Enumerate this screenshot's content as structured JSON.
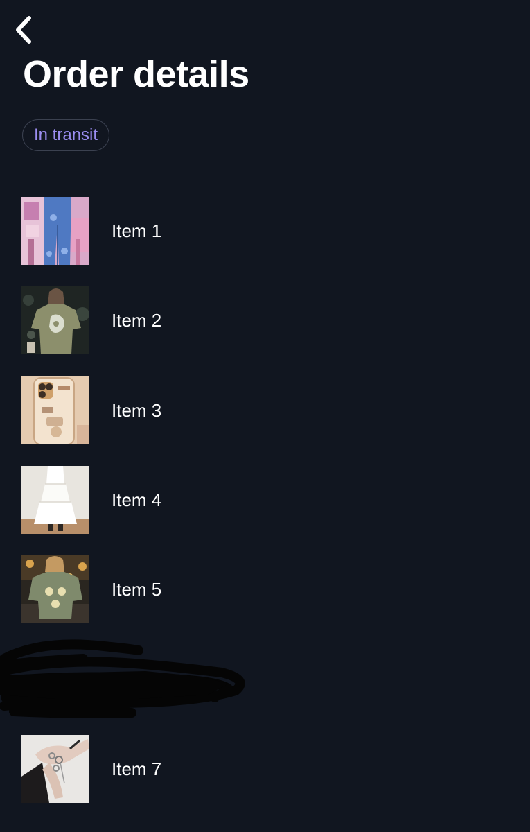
{
  "header": {
    "back_icon": "chevron-left-icon",
    "title": "Order details"
  },
  "status": {
    "label": "In transit",
    "color": "#9b8df0"
  },
  "colors": {
    "background": "#111620",
    "text": "#ffffff",
    "badge_border": "#3b4150"
  },
  "items": [
    {
      "label": "Item 1",
      "thumbnail": "blue-jeans-photo"
    },
    {
      "label": "Item 2",
      "thumbnail": "olive-graphic-tee-photo"
    },
    {
      "label": "Item 3",
      "thumbnail": "phone-case-photo"
    },
    {
      "label": "Item 4",
      "thumbnail": "white-tiered-skirt-photo"
    },
    {
      "label": "Item 5",
      "thumbnail": "green-skull-tee-photo"
    },
    {
      "label": "Item 7",
      "thumbnail": "silver-rings-photo"
    }
  ]
}
